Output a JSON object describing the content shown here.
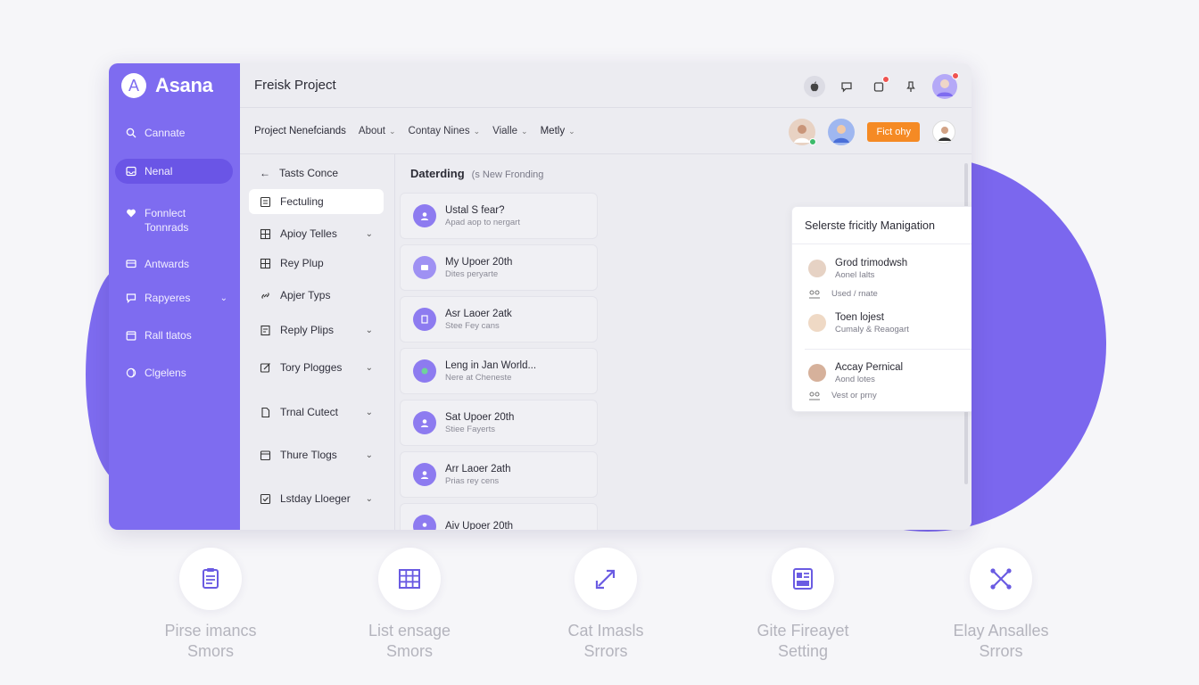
{
  "brand": {
    "name": "Asana",
    "logo_letter": "A"
  },
  "colors": {
    "accent": "#7e6cf0",
    "orange": "#f58a24",
    "online": "#3dbb6b"
  },
  "header": {
    "project_title": "Freisk Project"
  },
  "sidebar": {
    "items": [
      {
        "label": "Cannate",
        "icon": "search-icon"
      },
      {
        "label": "Nenal",
        "icon": "inbox-icon",
        "active": true
      },
      {
        "label_line1": "Fonnlect",
        "label_line2": "Tonnrads",
        "icon": "heart-icon"
      },
      {
        "label": "Antwards",
        "icon": "card-icon"
      },
      {
        "label": "Rapyeres",
        "icon": "chat-icon",
        "caret": "⌄"
      },
      {
        "label": "Rall tlatos",
        "icon": "calendar-icon"
      },
      {
        "label": "Clgelens",
        "icon": "globe-icon"
      }
    ]
  },
  "nav": {
    "links": [
      {
        "label": "Project Nenefciands",
        "chevron": ""
      },
      {
        "label": "About",
        "chevron": "⌄"
      },
      {
        "label": "Contay Nines",
        "chevron": "⌄"
      },
      {
        "label": "Vialle",
        "chevron": "⌄"
      },
      {
        "label": "Metly",
        "chevron": "⌄"
      }
    ],
    "action_button": "Fict ohy"
  },
  "submenu": {
    "back_label": "Tasts Conce",
    "items": [
      {
        "label": "Fectuling",
        "icon": "checklist-icon",
        "active": true
      },
      {
        "label": "Apioy Telles",
        "icon": "grid-icon",
        "caret": "⌄"
      },
      {
        "label": "Rey Plup",
        "icon": "grid-icon"
      },
      {
        "label": "Apjer Typs",
        "icon": "link-icon"
      },
      {
        "label": "Reply Plips",
        "icon": "doc-icon",
        "caret": "⌄"
      },
      {
        "label": "Tory Plogges",
        "icon": "edit-icon",
        "caret": "⌄"
      },
      {
        "label": "Trnal Cutect",
        "icon": "file-icon",
        "caret": "⌄"
      },
      {
        "label": "Thure Tlogs",
        "icon": "calendar-icon",
        "caret": "⌄"
      },
      {
        "label": "Lstday Lloeger",
        "icon": "check-square-icon",
        "caret": "⌄"
      }
    ]
  },
  "tasks": {
    "header_title": "Daterding",
    "header_sub": "(s New Fronding",
    "cards": [
      {
        "title": "Ustal S fear?",
        "sub": "Apad aop to nergart"
      },
      {
        "title": "My Upoer 20th",
        "sub": "Dites peryarte"
      },
      {
        "title": "Asr Laoer 2atk",
        "sub": "Stee Fey cans"
      },
      {
        "title": "Leng in Jan World...",
        "sub": "Nere at Cheneste"
      },
      {
        "title": "Sat Upoer 20th",
        "sub": "Stiee Fayerts"
      },
      {
        "title": "Arr Laoer 2ath",
        "sub": "Prias rey cens"
      },
      {
        "title": "Aiv Upoer 20th",
        "sub": ""
      }
    ]
  },
  "popup": {
    "title": "Selerste fricitly Manigation",
    "close": "×",
    "entries": [
      {
        "name": "Grod trimodwsh",
        "sub": "Aonel Ialts"
      },
      {
        "name": "Toen lojest",
        "sub": "Cumaly & Reaogart"
      },
      {
        "name": "Accay Pernical",
        "sub": "Aond lotes"
      }
    ],
    "meta": [
      "Used / rnate",
      "Vest or prny"
    ]
  },
  "features": [
    {
      "line1": "Pirse imancs",
      "line2": "Smors",
      "icon": "clipboard-icon"
    },
    {
      "line1": "List ensage",
      "line2": "Smors",
      "icon": "table-icon"
    },
    {
      "line1": "Cat Imasls",
      "line2": "Srrors",
      "icon": "expand-arrows-icon"
    },
    {
      "line1": "Gite Fireayet",
      "line2": "Setting",
      "icon": "layout-icon"
    },
    {
      "line1": "Elay Ansalles",
      "line2": "Srrors",
      "icon": "cross-arrows-icon"
    }
  ]
}
